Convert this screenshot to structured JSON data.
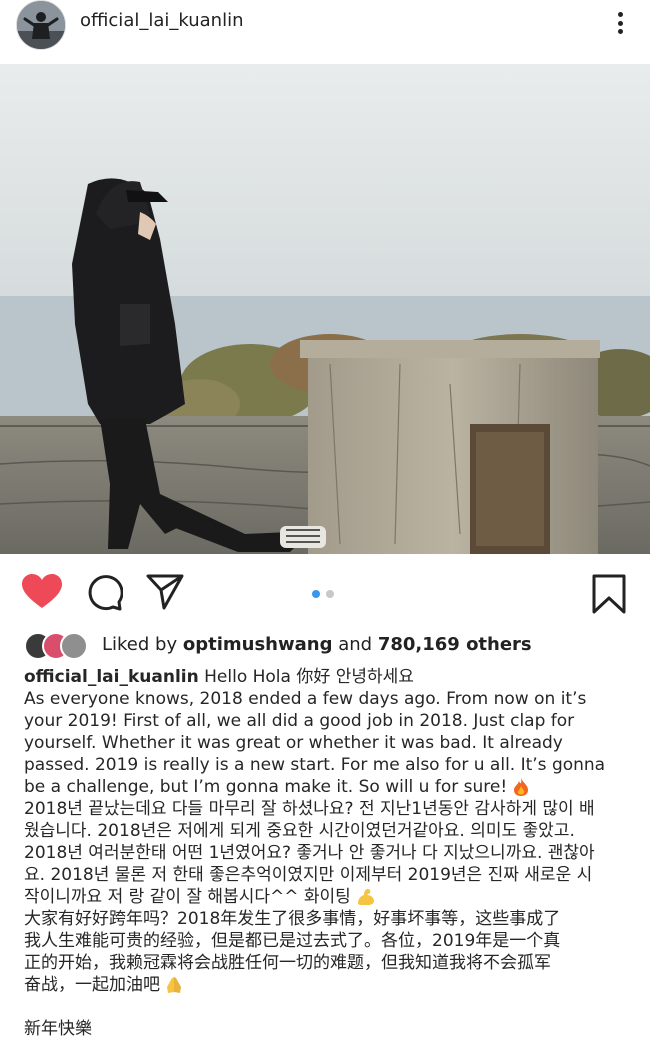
{
  "post": {
    "username": "official_lai_kuanlin",
    "more_icon": "more-dots-icon"
  },
  "photo": {
    "sky_color": "#dfe4e6",
    "sea_color": "#b7c3c9"
  },
  "actions": {
    "like_icon": "heart-filled-icon",
    "like_color": "#ed4956",
    "comment_icon": "comment-icon",
    "share_icon": "paper-plane-icon",
    "save_icon": "bookmark-icon",
    "carousel_active_color": "#3897f0"
  },
  "likes": {
    "prefix": "Liked by",
    "user": "optimushwang",
    "joiner": "and",
    "count": "780,169 others"
  },
  "caption": {
    "owner": "official_lai_kuanlin",
    "first": "Hello Hola 你好 안녕하세요",
    "lines": [
      "As everyone knows, 2018 ended a few days ago. From now on it’s",
      "your 2019! First of all, we all did a good job in 2018. Just clap for",
      "yourself. Whether it was great or whether it was bad. It already",
      "passed. 2019 is really is a new start. For me also for u all. It’s gonna",
      "be a challenge, but I’m gonna make it. So will u for sure!",
      "2018년 끝났는데요 다들 마무리 잘 하셨나요? 전 지난1년동안 감사하게 많이 배",
      "웠습니다. 2018년은 저에게 되게 중요한 시간이였던거같아요. 의미도 좋았고.",
      "2018년 여러분한태 어떤 1년였어요? 좋거나 안 좋거나 다 지났으니까요. 괜찮아",
      "요. 2018년 물론 저 한태 좋은추억이였지만 이제부터 2019년은 진짜 새로운 시",
      "작이니까요 저 랑 같이 잘 해봅시다^^ 화이팅",
      "大家有好好跨年吗？2018年发生了很多事情，好事坏事等，这些事成了",
      "我人生难能可贵的经验，但是都已是过去式了。各位，2019年是一个真",
      "正的开始，我赖冠霖将会战胜任何一切的难题，但我知道我将不会孤军",
      "奋战，一起加油吧"
    ],
    "closing": "新年快樂"
  }
}
